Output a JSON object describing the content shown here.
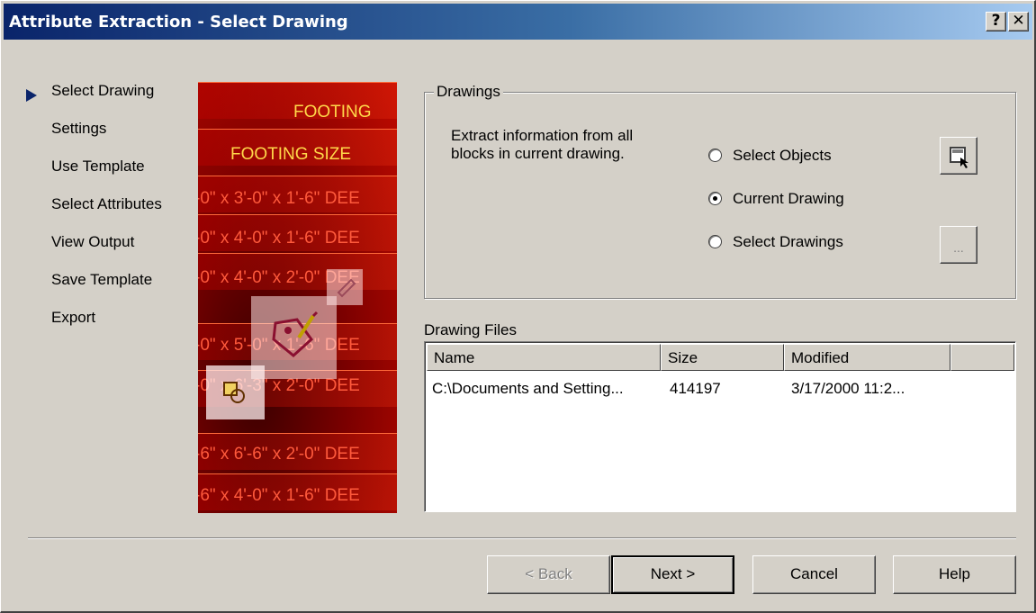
{
  "window": {
    "title": "Attribute Extraction - Select Drawing",
    "help_button": "?",
    "close_button": "✕"
  },
  "steps": [
    {
      "label": "Select Drawing",
      "current": true
    },
    {
      "label": "Settings",
      "current": false
    },
    {
      "label": "Use Template",
      "current": false
    },
    {
      "label": "Select Attributes",
      "current": false
    },
    {
      "label": "View Output",
      "current": false
    },
    {
      "label": "Save Template",
      "current": false
    },
    {
      "label": "Export",
      "current": false
    }
  ],
  "preview": {
    "lines": [
      "FOOTING",
      "FOOTING SIZE",
      "-0\" x 3'-0\" x 1'-6\" DEE",
      "-0\" x 4'-0\" x 1'-6\" DEE",
      "-0\" x 4'-0\" x 2'-0\" DEE",
      "-0\" x 5'-0\" x 1'-6\" DEE",
      "-0\" x 6'-3\" x 2'-0\" DEE",
      "-6\" x 6'-6\" x 2'-0\" DEE",
      "-6\" x 4'-0\" x 1'-6\" DEE"
    ]
  },
  "drawings": {
    "group_label": "Drawings",
    "description": "Extract information from all blocks in current drawing.",
    "options": [
      {
        "label": "Select Objects",
        "selected": false
      },
      {
        "label": "Current Drawing",
        "selected": true
      },
      {
        "label": "Select Drawings",
        "selected": false
      }
    ],
    "browse_button": "..."
  },
  "files": {
    "label": "Drawing Files",
    "columns": [
      "Name",
      "Size",
      "Modified"
    ],
    "rows": [
      {
        "name": "C:\\Documents and Setting...",
        "size": "414197",
        "modified": "3/17/2000 11:2..."
      }
    ]
  },
  "buttons": {
    "back": "< Back",
    "next": "Next >",
    "cancel": "Cancel",
    "help": "Help"
  },
  "colors": {
    "title_start": "#0a246a",
    "title_end": "#a6caf0",
    "face": "#d4d0c8",
    "step_arrow": "#0a246a"
  }
}
